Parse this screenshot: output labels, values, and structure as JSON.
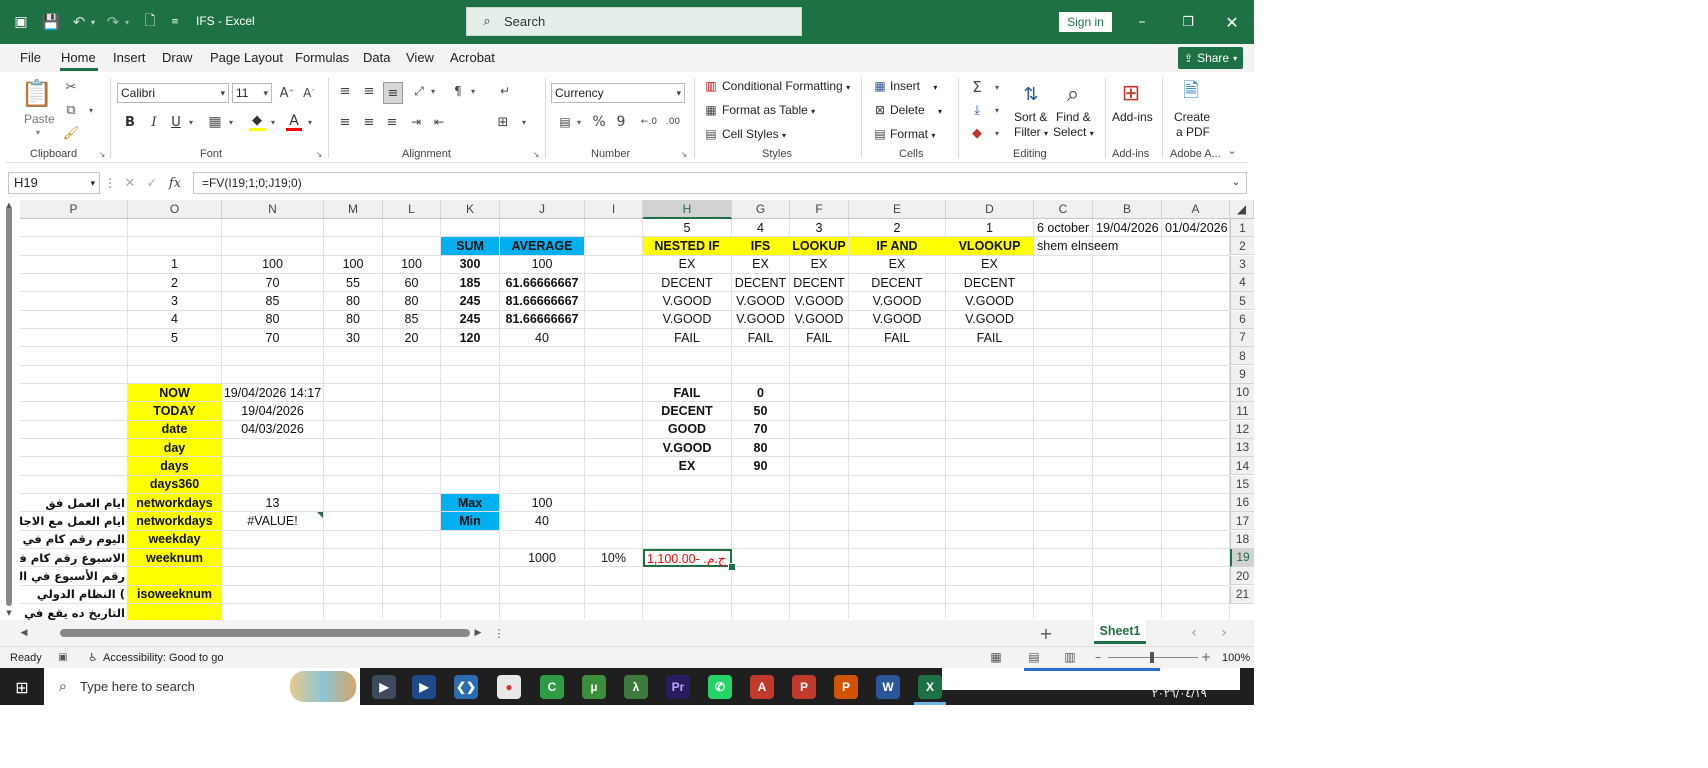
{
  "window": {
    "title": "IFS  -  Excel",
    "search_placeholder": "Search",
    "sign_in": "Sign in"
  },
  "menu": {
    "tabs": [
      "File",
      "Home",
      "Insert",
      "Draw",
      "Page Layout",
      "Formulas",
      "Data",
      "View",
      "Acrobat"
    ],
    "active": "Home",
    "share": "Share"
  },
  "ribbon": {
    "clipboard": {
      "label": "Clipboard",
      "paste": "Paste"
    },
    "font": {
      "label": "Font",
      "name": "Calibri",
      "size": "11"
    },
    "alignment": {
      "label": "Alignment"
    },
    "number": {
      "label": "Number",
      "format": "Currency"
    },
    "styles": {
      "label": "Styles",
      "conditional": "Conditional Formatting",
      "format_table": "Format as Table",
      "cell_styles": "Cell Styles"
    },
    "cells": {
      "label": "Cells",
      "insert": "Insert",
      "delete": "Delete",
      "format": "Format"
    },
    "editing": {
      "label": "Editing",
      "sort1": "Sort &",
      "sort2": "Filter",
      "find1": "Find &",
      "find2": "Select"
    },
    "addins": {
      "label": "Add-ins",
      "btn": "Add-ins"
    },
    "adobe": {
      "label": "Adobe A...",
      "btn1": "Create",
      "btn2": "a PDF"
    }
  },
  "formula_bar": {
    "name_box": "H19",
    "formula": "=FV(I19;1;0;J19;0)"
  },
  "columns": [
    "P",
    "O",
    "N",
    "M",
    "L",
    "K",
    "J",
    "I",
    "H",
    "G",
    "F",
    "E",
    "D",
    "C",
    "B",
    "A"
  ],
  "rows": [
    "1",
    "2",
    "3",
    "4",
    "5",
    "6",
    "7",
    "8",
    "9",
    "10",
    "11",
    "12",
    "13",
    "14",
    "15",
    "16",
    "17",
    "18",
    "19",
    "20",
    "21"
  ],
  "cells": {
    "r1": {
      "H": "5",
      "G": "4",
      "F": "3",
      "E": "2",
      "D": "1",
      "C": "6 october",
      "B": "19/04/2026",
      "A": "01/04/2026"
    },
    "r2": {
      "K": "SUM",
      "J": "AVERAGE",
      "H": "NESTED IF",
      "G": "IFS",
      "F": "LOOKUP",
      "E": "IF AND",
      "D": "VLOOKUP",
      "C": "shem elnseem"
    },
    "r3": {
      "O": "1",
      "N": "100",
      "M": "100",
      "L": "100",
      "K": "300",
      "J": "100",
      "H": "EX",
      "G": "EX",
      "F": "EX",
      "E": "EX",
      "D": "EX"
    },
    "r4": {
      "O": "2",
      "N": "70",
      "M": "55",
      "L": "60",
      "K": "185",
      "J": "61.66666667",
      "H": "DECENT",
      "G": "DECENT",
      "F": "DECENT",
      "E": "DECENT",
      "D": "DECENT"
    },
    "r5": {
      "O": "3",
      "N": "85",
      "M": "80",
      "L": "80",
      "K": "245",
      "J": "81.66666667",
      "H": "V.GOOD",
      "G": "V.GOOD",
      "F": "V.GOOD",
      "E": "V.GOOD",
      "D": "V.GOOD"
    },
    "r6": {
      "O": "4",
      "N": "80",
      "M": "80",
      "L": "85",
      "K": "245",
      "J": "81.66666667",
      "H": "V.GOOD",
      "G": "V.GOOD",
      "F": "V.GOOD",
      "E": "V.GOOD",
      "D": "V.GOOD"
    },
    "r7": {
      "O": "5",
      "N": "70",
      "M": "30",
      "L": "20",
      "K": "120",
      "J": "40",
      "H": "FAIL",
      "G": "FAIL",
      "F": "FAIL",
      "E": "FAIL",
      "D": "FAIL"
    },
    "r10": {
      "O": "NOW",
      "N": "19/04/2026 14:17",
      "H": "FAIL",
      "G": "0"
    },
    "r11": {
      "O": "TODAY",
      "N": "19/04/2026",
      "H": "DECENT",
      "G": "50"
    },
    "r12": {
      "O": "date",
      "N": "04/03/2026",
      "H": "GOOD",
      "G": "70"
    },
    "r13": {
      "O": "day",
      "H": "V.GOOD",
      "G": "80"
    },
    "r14": {
      "O": "days",
      "H": "EX",
      "G": "90"
    },
    "r15": {
      "O": "days360"
    },
    "r16": {
      "P": "ايام العمل فق",
      "O": "networkdays",
      "N": "13",
      "K": "Max",
      "J": "100"
    },
    "r17": {
      "P": "ايام العمل مع الاجازات",
      "O": "networkdays",
      "N": "#VALUE!",
      "K": "Min",
      "J": "40"
    },
    "r18": {
      "P": "اليوم رقم كام في ال",
      "O": "weekday"
    },
    "r19": {
      "P": "الاسبوع رقم كام في",
      "O": "weeknum",
      "J": "1000",
      "I": "10%",
      "H": "ج.م.‏ -1,100.00"
    },
    "r20": {
      "P": "رقم الأسبوع في السن"
    },
    "r21": {
      "P": "النظام الدولي (",
      "O": "isoweeknum"
    },
    "r22": {
      "P": "التاريخ ده يقع في الأس"
    }
  },
  "sheet_tabs": {
    "active": "Sheet1"
  },
  "status": {
    "ready": "Ready",
    "accessibility": "Accessibility: Good to go",
    "zoom": "100%"
  },
  "taskbar": {
    "search_placeholder": "Type here to search",
    "date": "٢٠٢٦/٠٤/١٩"
  },
  "colors": {
    "excel_green": "#1e7145",
    "yellow": "#ffff00",
    "blue": "#00b0f0",
    "negative": "#ff0000"
  }
}
